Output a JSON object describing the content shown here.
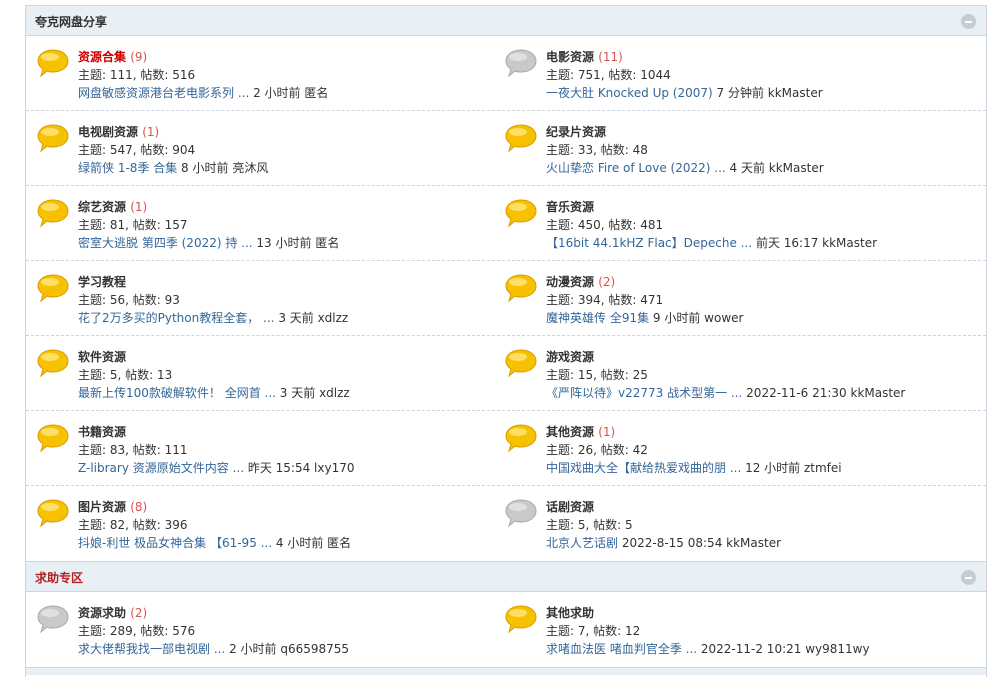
{
  "colors": {
    "accent_red": "#cc0000",
    "count_red": "#d9534f",
    "link_blue": "#336699",
    "header_bg": "#e8eff5",
    "bubble_gold": "#f5c400",
    "bubble_grey": "#c8c8c8"
  },
  "categories": [
    {
      "title": "夸克网盘分享",
      "forums": [
        {
          "name": "资源合集",
          "count": "(9)",
          "stats": "主题: 111, 帖数: 516",
          "last_link": "网盘敏感资源港台老电影系列 ...",
          "last_meta": " 2 小时前 匿名",
          "icon": "new-posts-bubble-icon",
          "highlight": true
        },
        {
          "name": "电影资源",
          "count": "(11)",
          "stats": "主题: 751, 帖数: 1044",
          "last_link": "一夜大肚 Knocked Up (2007)",
          "last_meta": " 7 分钟前 kkMaster",
          "icon": "no-new-posts-bubble-icon"
        },
        {
          "name": "电视剧资源",
          "count": "(1)",
          "stats": "主题: 547, 帖数: 904",
          "last_link": "绿箭侠 1-8季 合集",
          "last_meta": " 8 小时前 亮沐风",
          "icon": "new-posts-bubble-icon"
        },
        {
          "name": "纪录片资源",
          "count": "",
          "stats": "主题: 33, 帖数: 48",
          "last_link": "火山挚恋 Fire of Love (2022) ...",
          "last_meta": " 4 天前 kkMaster",
          "icon": "new-posts-bubble-icon"
        },
        {
          "name": "综艺资源",
          "count": "(1)",
          "stats": "主题: 81, 帖数: 157",
          "last_link": "密室大逃脱 第四季 (2022) 持 ...",
          "last_meta": " 13 小时前 匿名",
          "icon": "new-posts-bubble-icon"
        },
        {
          "name": "音乐资源",
          "count": "",
          "stats": "主题: 450, 帖数: 481",
          "last_link": "【16bit 44.1kHZ Flac】Depeche ...",
          "last_meta": " 前天 16:17 kkMaster",
          "icon": "new-posts-bubble-icon"
        },
        {
          "name": "学习教程",
          "count": "",
          "stats": "主题: 56, 帖数: 93",
          "last_link": "花了2万多买的Python教程全套， ...",
          "last_meta": " 3 天前 xdlzz",
          "icon": "new-posts-bubble-icon"
        },
        {
          "name": "动漫资源",
          "count": "(2)",
          "stats": "主题: 394, 帖数: 471",
          "last_link": "魔神英雄传 全91集",
          "last_meta": " 9 小时前 wower",
          "icon": "new-posts-bubble-icon"
        },
        {
          "name": "软件资源",
          "count": "",
          "stats": "主题: 5, 帖数: 13",
          "last_link": "最新上传100款破解软件！ 全网首 ...",
          "last_meta": " 3 天前 xdlzz",
          "icon": "new-posts-bubble-icon"
        },
        {
          "name": "游戏资源",
          "count": "",
          "stats": "主题: 15, 帖数: 25",
          "last_link": "《严阵以待》v22773 战术型第一 ...",
          "last_meta": " 2022-11-6 21:30 kkMaster",
          "icon": "new-posts-bubble-icon"
        },
        {
          "name": "书籍资源",
          "count": "",
          "stats": "主题: 83, 帖数: 111",
          "last_link": "Z-library 资源原始文件内容 ...",
          "last_meta": " 昨天 15:54 lxy170",
          "icon": "new-posts-bubble-icon"
        },
        {
          "name": "其他资源",
          "count": "(1)",
          "stats": "主题: 26, 帖数: 42",
          "last_link": "中国戏曲大全【献给热爱戏曲的朋 ...",
          "last_meta": " 12 小时前 ztmfei",
          "icon": "new-posts-bubble-icon"
        },
        {
          "name": "图片资源",
          "count": "(8)",
          "stats": "主题: 82, 帖数: 396",
          "last_link": "抖娘-利世 极品女神合集 【61-95 ...",
          "last_meta": " 4 小时前 匿名",
          "icon": "new-posts-bubble-icon"
        },
        {
          "name": "话剧资源",
          "count": "",
          "stats": "主题: 5, 帖数: 5",
          "last_link": "北京人艺话剧",
          "last_meta": " 2022-8-15 08:54 kkMaster",
          "icon": "no-new-posts-bubble-icon"
        }
      ]
    },
    {
      "title": "求助专区",
      "forums": [
        {
          "name": "资源求助",
          "count": "(2)",
          "stats": "主题: 289, 帖数: 576",
          "last_link": "求大佬帮我找一部电视剧 ...",
          "last_meta": " 2 小时前 q66598755",
          "icon": "no-new-posts-bubble-icon"
        },
        {
          "name": "其他求助",
          "count": "",
          "stats": "主题: 7, 帖数: 12",
          "last_link": "求啫血法医 啫血判官全季 ...",
          "last_meta": " 2022-11-2 10:21 wy9811wy",
          "icon": "new-posts-bubble-icon"
        }
      ]
    }
  ]
}
